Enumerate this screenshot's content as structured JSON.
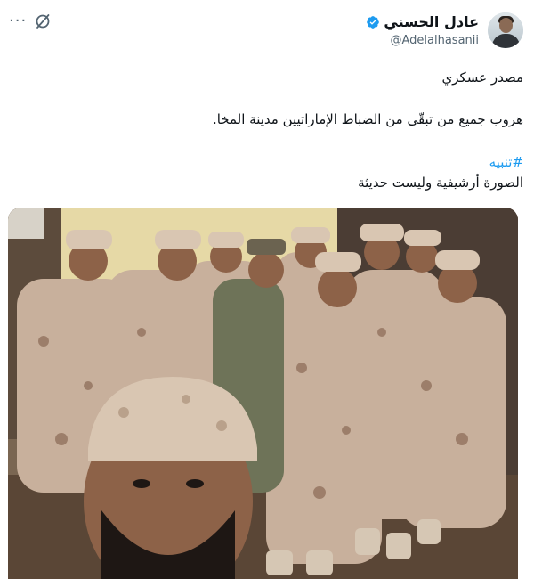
{
  "author": {
    "display_name": "عادل الحسني",
    "handle": "@Adelalhasanii",
    "verified": true,
    "avatar": "avatar"
  },
  "header_icons": {
    "more": "more-options-icon",
    "grok": "grok-icon"
  },
  "tweet": {
    "line1": "مصدر عسكري",
    "line2": "هروب جميع من تبقّى من الضباط الإماراتيين مدينة المخا.",
    "hashtag": "#تنبيه",
    "line4": "الصورة أرشيفية وليست حديثة"
  },
  "media": {
    "description_icon": "group-photo-image"
  },
  "colors": {
    "accent": "#1d9bf0",
    "text": "#0f1419",
    "secondary": "#536471"
  }
}
